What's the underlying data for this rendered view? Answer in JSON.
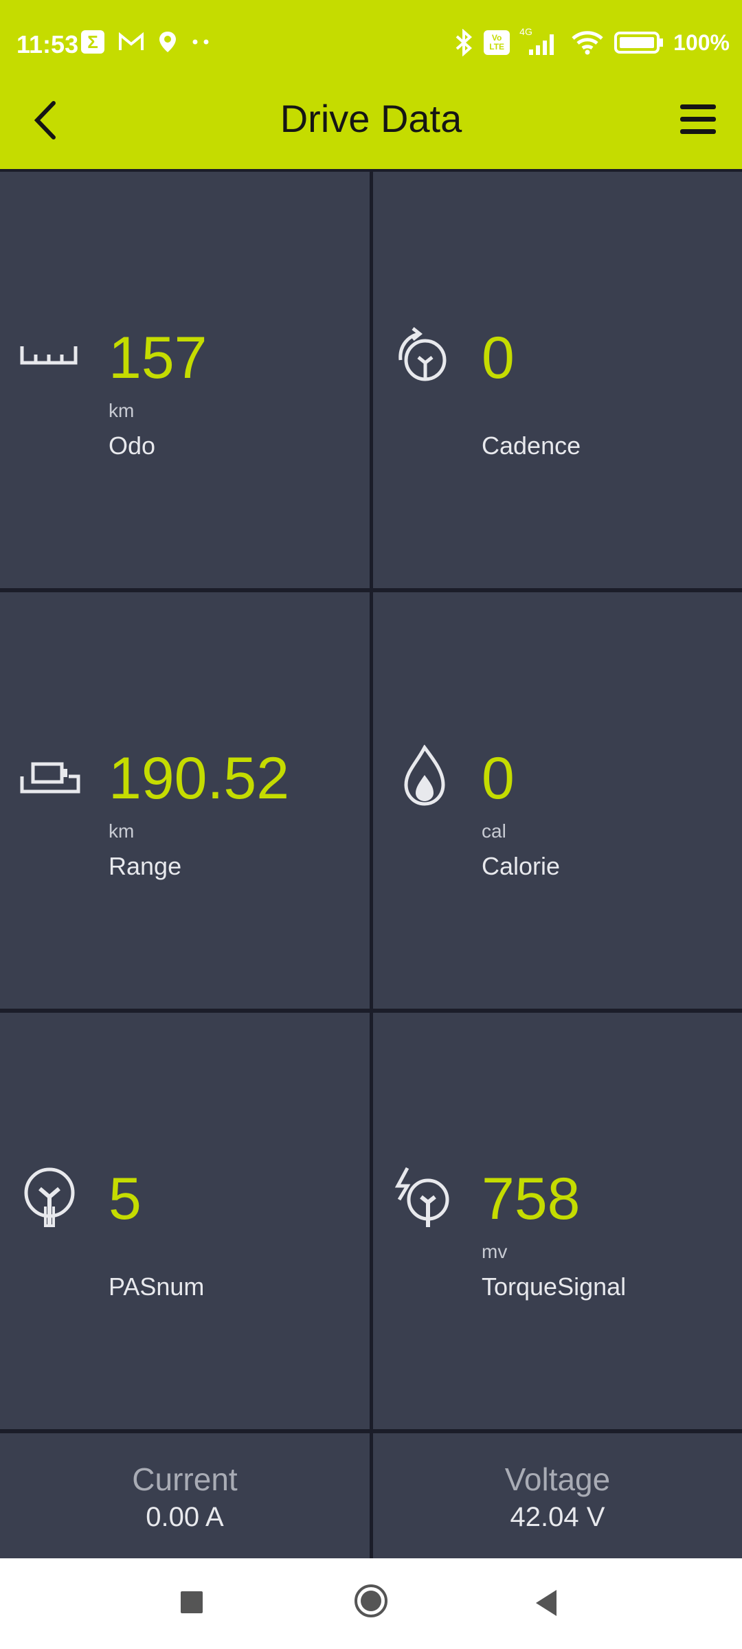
{
  "status_bar": {
    "time": "11:53",
    "battery": "100%",
    "network": "4G",
    "volte": "Vo LTE"
  },
  "header": {
    "title": "Drive Data"
  },
  "tiles": [
    {
      "id": "odo",
      "icon": "ruler-icon",
      "value": "157",
      "unit": "km",
      "label": "Odo"
    },
    {
      "id": "cadence",
      "icon": "cadence-crank-icon",
      "value": "0",
      "unit": "",
      "label": "Cadence"
    },
    {
      "id": "range",
      "icon": "battery-range-icon",
      "value": "190.52",
      "unit": "km",
      "label": "Range"
    },
    {
      "id": "calorie",
      "icon": "flame-icon",
      "value": "0",
      "unit": "cal",
      "label": "Calorie"
    },
    {
      "id": "pasnum",
      "icon": "pas-crank-icon",
      "value": "5",
      "unit": "",
      "label": "PASnum"
    },
    {
      "id": "torque",
      "icon": "torque-signal-icon",
      "value": "758",
      "unit": "mv",
      "label": "TorqueSignal"
    }
  ],
  "bottom": {
    "current": {
      "title": "Current",
      "value": "0.00 A"
    },
    "voltage": {
      "title": "Voltage",
      "value": "42.04 V"
    }
  },
  "colors": {
    "accent": "#c5dc00",
    "tile_bg": "#3a3f4f",
    "divider": "#1b1d29"
  }
}
